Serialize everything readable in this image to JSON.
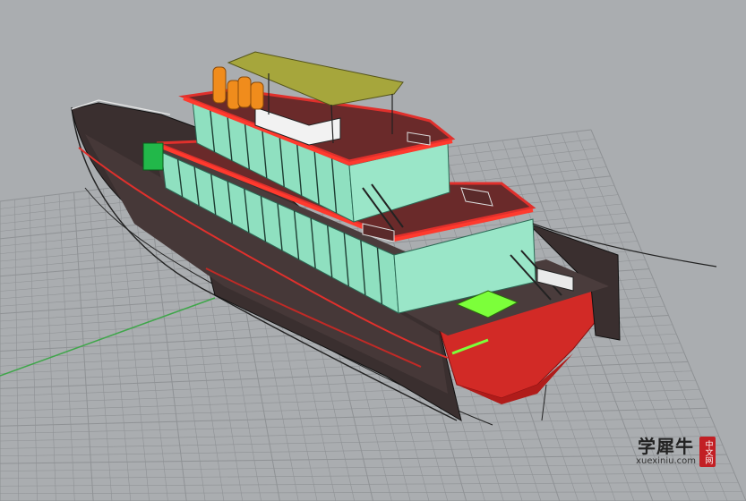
{
  "viewport": {
    "background_color": "#aaadb0",
    "grid_color": "#8f9295",
    "x_axis_color": "#b04040",
    "y_axis_color": "#3fa64a"
  },
  "model": {
    "hull_color": "#3a2f2f",
    "trim_color": "#e0302c",
    "glass_color": "#8fe0c0",
    "roof_color": "#a6a63c",
    "tank_color": "#f08c1c",
    "highlight_color": "#7cff3a"
  },
  "watermark": {
    "brand": "学犀牛",
    "url": "xuexiniu.com",
    "seal": "中文网"
  }
}
